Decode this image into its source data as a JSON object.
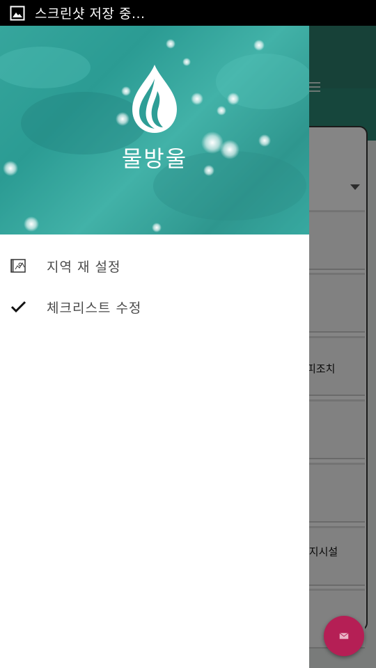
{
  "status_bar": {
    "text": "스크린샷 저장 중...",
    "icon": "image-icon"
  },
  "drawer": {
    "brand": "물방울",
    "logo_icon": "water-drop-icon",
    "items": [
      {
        "label": "지역 재 설정",
        "icon": "map-icon"
      },
      {
        "label": "체크리스트 수정",
        "icon": "check-icon"
      }
    ]
  },
  "background_app": {
    "row_labels": [
      "피조치",
      "방지시설"
    ],
    "fab_icon": "mail-icon",
    "colors": {
      "toolbar": "#2d7d6b",
      "tabbar": "#2b8773",
      "fab": "#b51f55"
    }
  }
}
